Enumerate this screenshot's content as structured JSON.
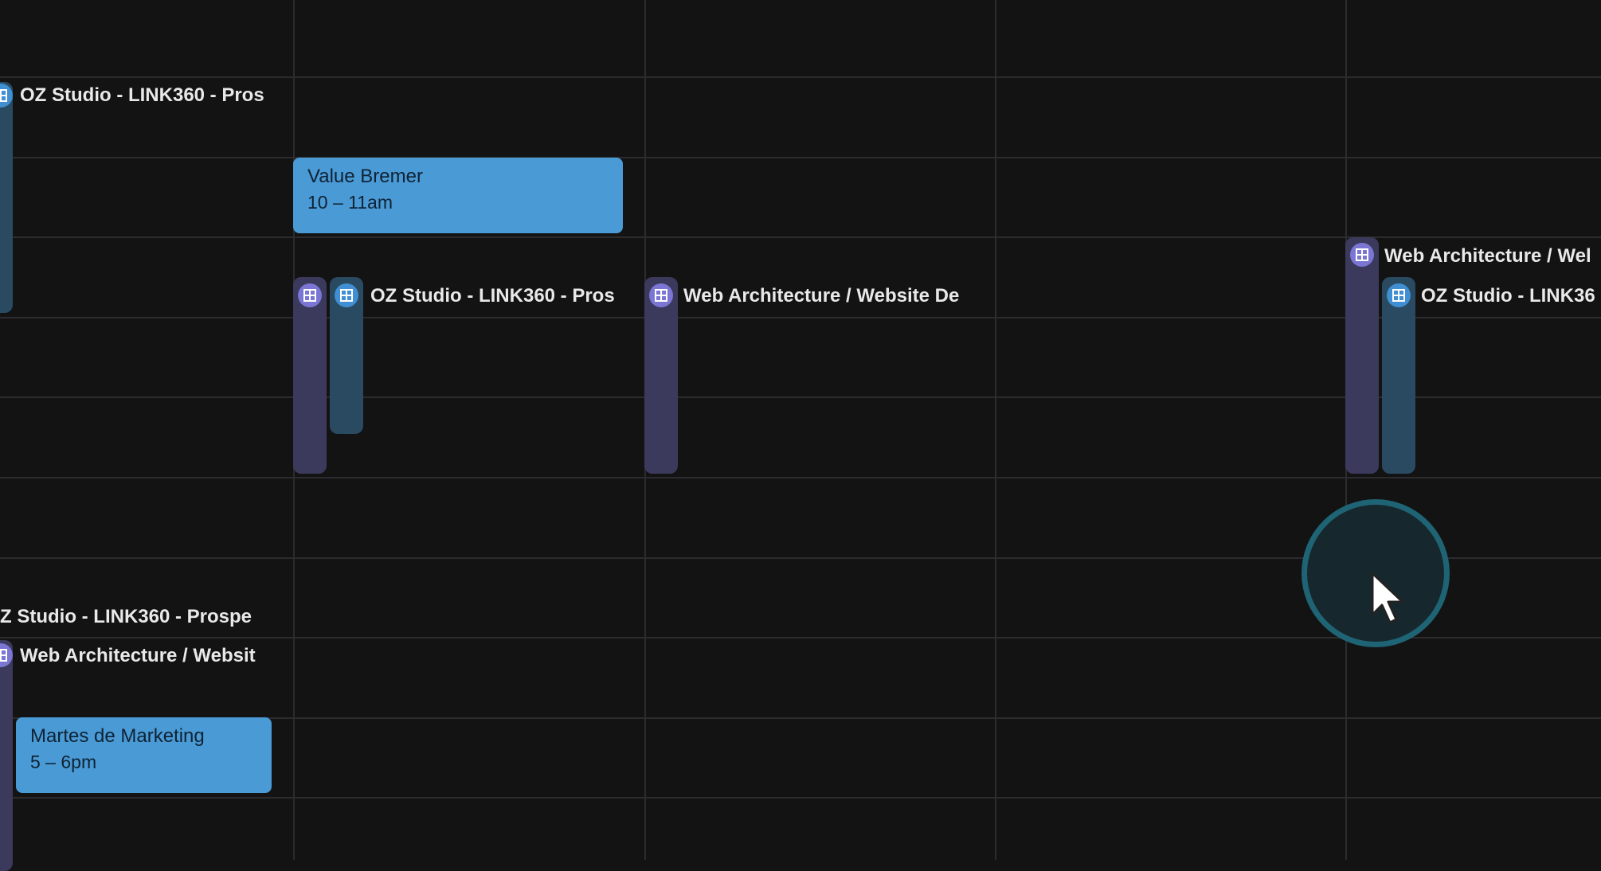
{
  "calendar": {
    "chips": [
      {
        "label": "OZ Studio - LINK360 - Pros"
      },
      {
        "label": "OZ Studio - LINK360 - Pros"
      },
      {
        "label": "Web Architecture / Website De"
      },
      {
        "label": "Web Architecture / Wel"
      },
      {
        "label": "OZ Studio - LINK36"
      },
      {
        "label": "Z Studio - LINK360 - Prospe"
      },
      {
        "label": "Web Architecture / Websit"
      }
    ],
    "events": [
      {
        "title": "Value Bremer",
        "time": "10 – 11am",
        "color": "#4a9ad6"
      },
      {
        "title": "Martes de Marketing",
        "time": "5 – 6pm",
        "color": "#4a9ad6"
      }
    ],
    "colors": {
      "background": "#131314",
      "gridline": "#2c2c2e",
      "purple_chip": "#7b76d4",
      "teal_chip": "#3f8fd2"
    }
  },
  "icons": {
    "chip": "calendar-grid-icon",
    "cursor": "mouse-pointer-icon"
  }
}
